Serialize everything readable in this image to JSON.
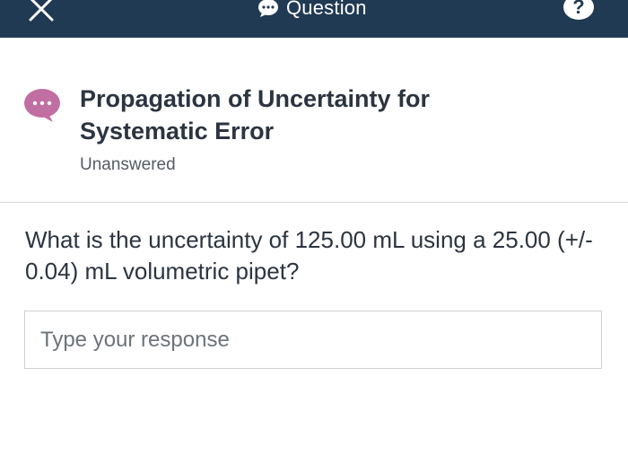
{
  "topbar": {
    "title": "Question",
    "close_icon": "close-icon",
    "help_label": "?",
    "colors": {
      "background": "#213a53",
      "text": "#ffffff"
    }
  },
  "question_header": {
    "icon": "chat-bubble-icon",
    "icon_color": "#c16fa3",
    "title": "Propagation of Uncertainty for Systematic Error",
    "status": "Unanswered"
  },
  "question": {
    "text": "What is the uncertainty of 125.00 mL using a 25.00 (+/- 0.04) mL volumetric pipet?"
  },
  "response": {
    "value": "",
    "placeholder": "Type your response"
  }
}
